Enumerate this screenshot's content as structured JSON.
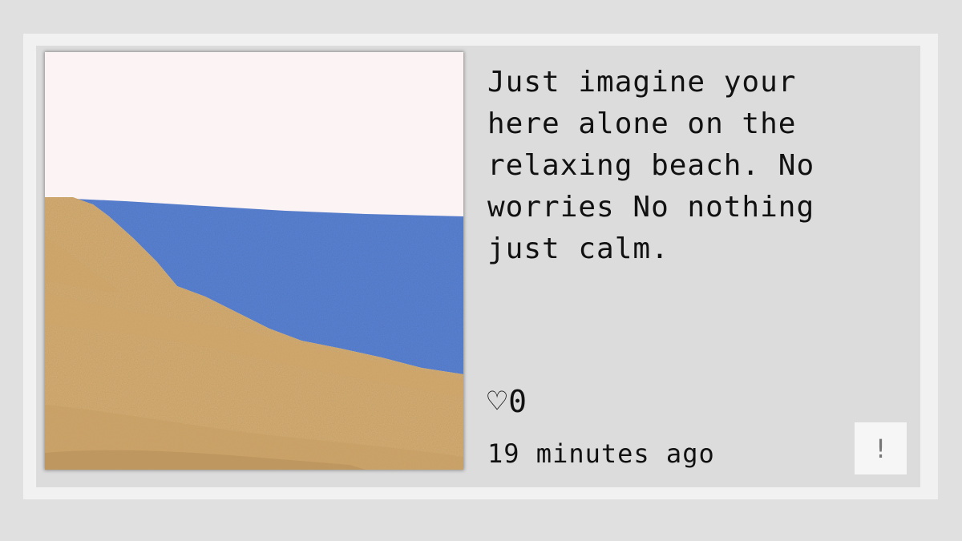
{
  "post": {
    "text": "Just imagine your\nhere alone on the\nrelaxing beach. No\nworries No nothing\njust calm.",
    "likes_icon": "heart-outline-icon",
    "heart_glyph": "♡",
    "likes": "0",
    "timestamp": "19 minutes ago",
    "report_label": "!"
  },
  "colors": {
    "sky": "#fcf3f5",
    "water": "#5b84d6",
    "sand": "#d8b074",
    "card_bg": "#dcdcdc",
    "frame_bg": "#f1f1f1",
    "page_bg": "#e0e0e0"
  }
}
